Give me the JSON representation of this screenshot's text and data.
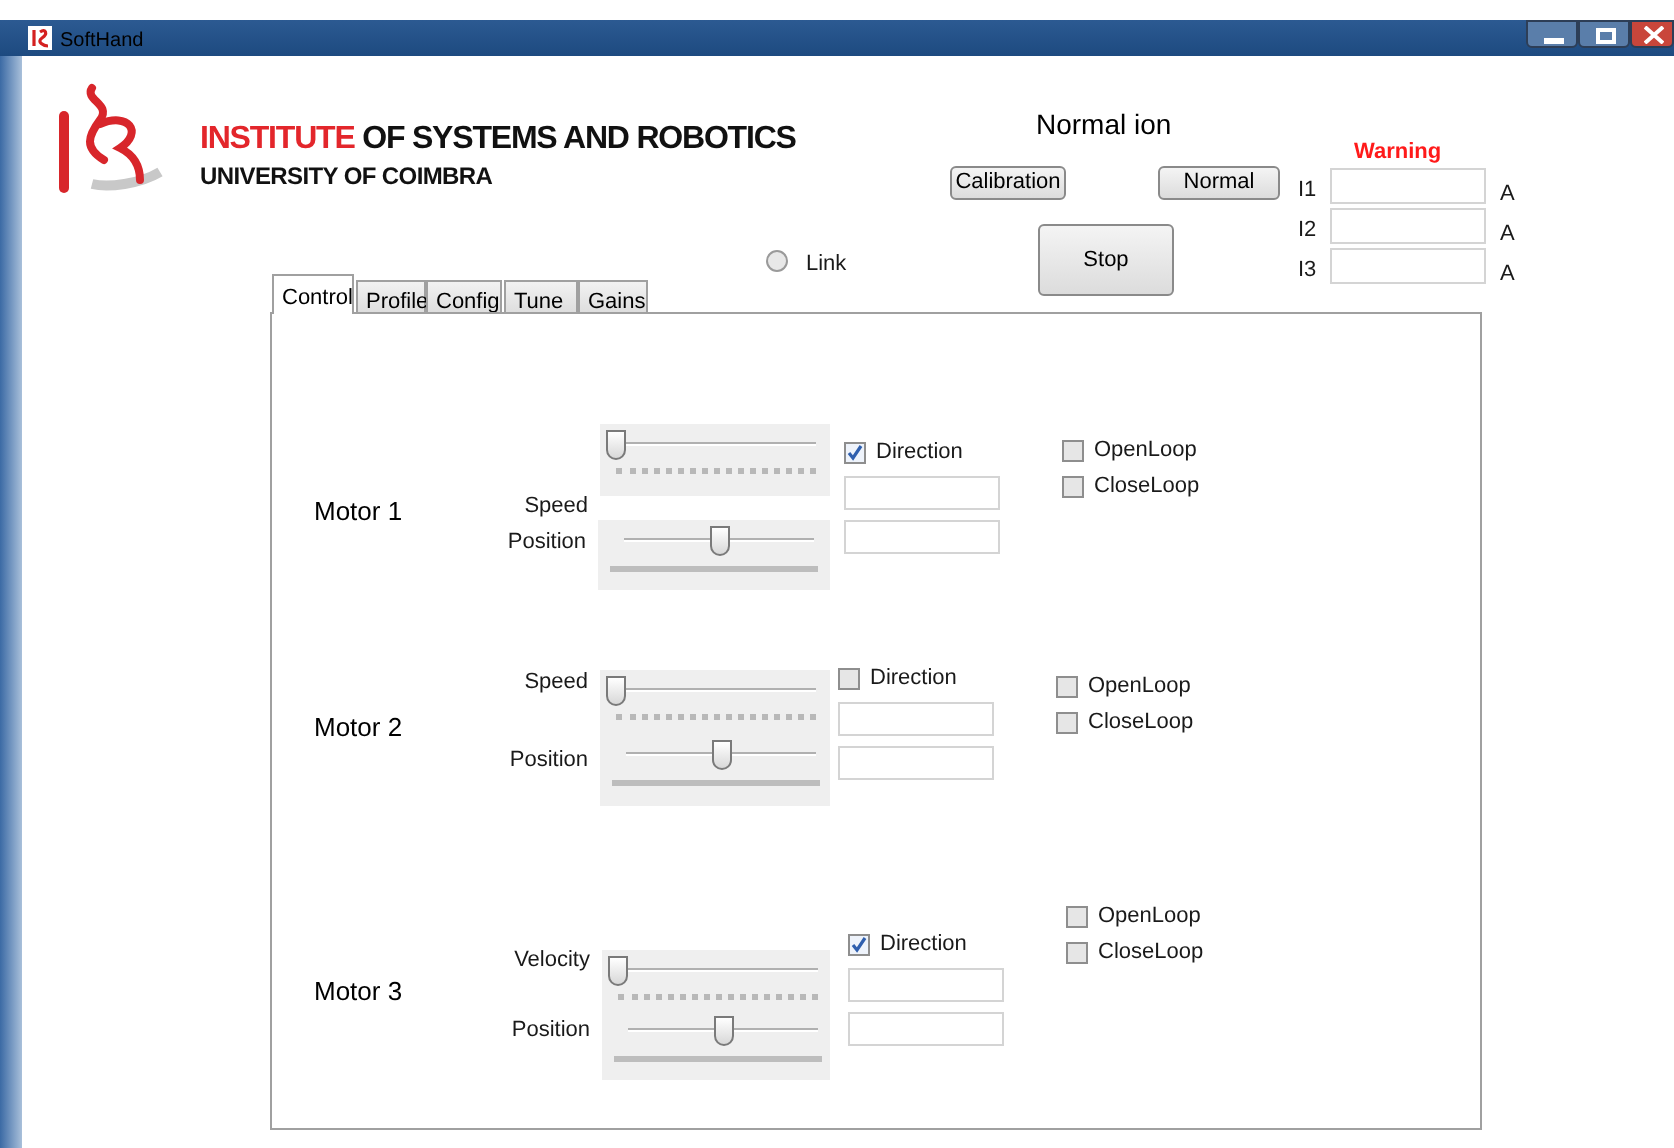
{
  "window": {
    "title": "SoftHand"
  },
  "header": {
    "institute_highlight": "INSTITUTE",
    "institute_rest": "OF SYSTEMS AND ROBOTICS",
    "university": "UNIVERSITY OF COIMBRA"
  },
  "mode_label": "Normal ion",
  "buttons": [
    {
      "label": "Calibration"
    },
    {
      "label": "Normal"
    },
    {
      "label": "Stop"
    }
  ],
  "link": {
    "label": "Link",
    "selected": false
  },
  "warning": "Warning",
  "currents": [
    {
      "label": "I1",
      "unit": "A"
    },
    {
      "label": "I2",
      "unit": "A"
    },
    {
      "label": "I3",
      "unit": "A"
    }
  ],
  "tabs": [
    {
      "label": "Control",
      "selected": true
    },
    {
      "label": "Profile",
      "selected": false
    },
    {
      "label": "Config",
      "selected": false
    },
    {
      "label": "Tune",
      "selected": false
    },
    {
      "label": "Gains",
      "selected": false
    }
  ],
  "motors": [
    {
      "name": "Motor 1",
      "sliders": [
        {
          "label": "Speed",
          "kind": "ticks",
          "level": 0
        },
        {
          "label": "Position",
          "kind": "bar",
          "level": 0.5
        }
      ],
      "direction": {
        "label": "Direction",
        "checked": true
      },
      "loops": [
        {
          "label": "OpenLoop",
          "checked": false
        },
        {
          "label": "CloseLoop",
          "checked": false
        }
      ]
    },
    {
      "name": "Motor 2",
      "sliders": [
        {
          "label": "Speed",
          "kind": "ticks",
          "level": 0
        },
        {
          "label": "Position",
          "kind": "bar",
          "level": 0.5
        }
      ],
      "direction": {
        "label": "Direction",
        "checked": false
      },
      "loops": [
        {
          "label": "OpenLoop",
          "checked": false
        },
        {
          "label": "CloseLoop",
          "checked": false
        }
      ]
    },
    {
      "name": "Motor 3",
      "sliders": [
        {
          "label": "Velocity",
          "kind": "ticks",
          "level": 0
        },
        {
          "label": "Position",
          "kind": "bar",
          "level": 0.5
        }
      ],
      "direction": {
        "label": "Direction",
        "checked": true
      },
      "loops": [
        {
          "label": "OpenLoop",
          "checked": false
        },
        {
          "label": "CloseLoop",
          "checked": false
        }
      ]
    }
  ]
}
